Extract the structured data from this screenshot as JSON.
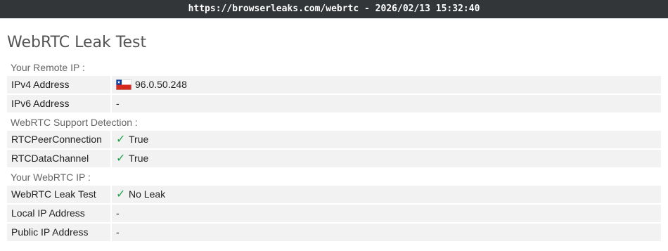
{
  "address_bar": {
    "text": "https://browserleaks.com/webrtc - 2026/02/13 15:32:40"
  },
  "page": {
    "title": "WebRTC Leak Test"
  },
  "sections": {
    "remote_ip": {
      "heading": "Your Remote IP :",
      "ipv4_label": "IPv4 Address",
      "ipv4_value": "96.0.50.248",
      "ipv4_flag": "chile-flag-icon",
      "ipv6_label": "IPv6 Address",
      "ipv6_value": "-"
    },
    "support": {
      "heading": "WebRTC Support Detection :",
      "peer_label": "RTCPeerConnection",
      "peer_value": "True",
      "channel_label": "RTCDataChannel",
      "channel_value": "True"
    },
    "webrtc_ip": {
      "heading": "Your WebRTC IP :",
      "leak_label": "WebRTC Leak Test",
      "leak_value": "No Leak",
      "local_label": "Local IP Address",
      "local_value": "-",
      "public_label": "Public IP Address",
      "public_value": "-"
    }
  },
  "colors": {
    "check_green": "#1fa34a",
    "row_background": "#f2f2f2",
    "topbar_background": "#323639"
  }
}
